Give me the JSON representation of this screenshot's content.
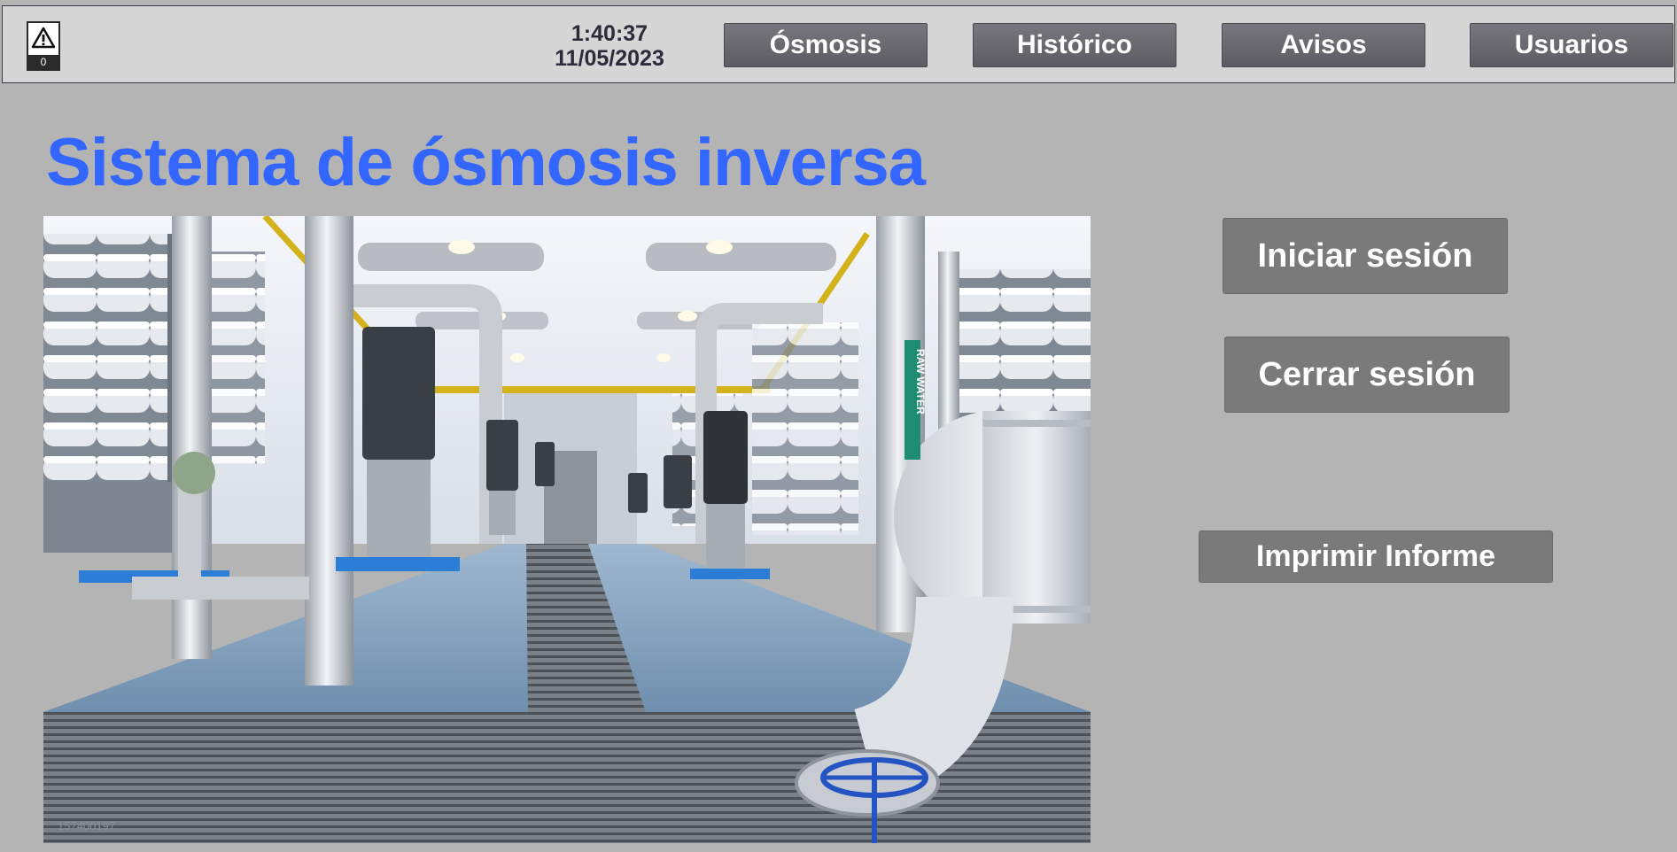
{
  "header": {
    "alarm_icon": "warning-triangle-icon",
    "alarm_count": "0",
    "time": "1:40:37",
    "date": "11/05/2023",
    "nav": [
      "Ósmosis",
      "Histórico",
      "Avisos",
      "Usuarios"
    ]
  },
  "main": {
    "title": "Sistema de ósmosis inversa",
    "photo": {
      "id_text": "157400197",
      "sign_text": "RAW WATER"
    },
    "buttons": {
      "login": "Iniciar sesión",
      "logout": "Cerrar sesión",
      "print": "Imprimir Informe"
    }
  },
  "colors": {
    "title": "#3366ff",
    "background": "#b4b4b4",
    "header": "#d6d6d6",
    "button": "#7a7a7a"
  }
}
